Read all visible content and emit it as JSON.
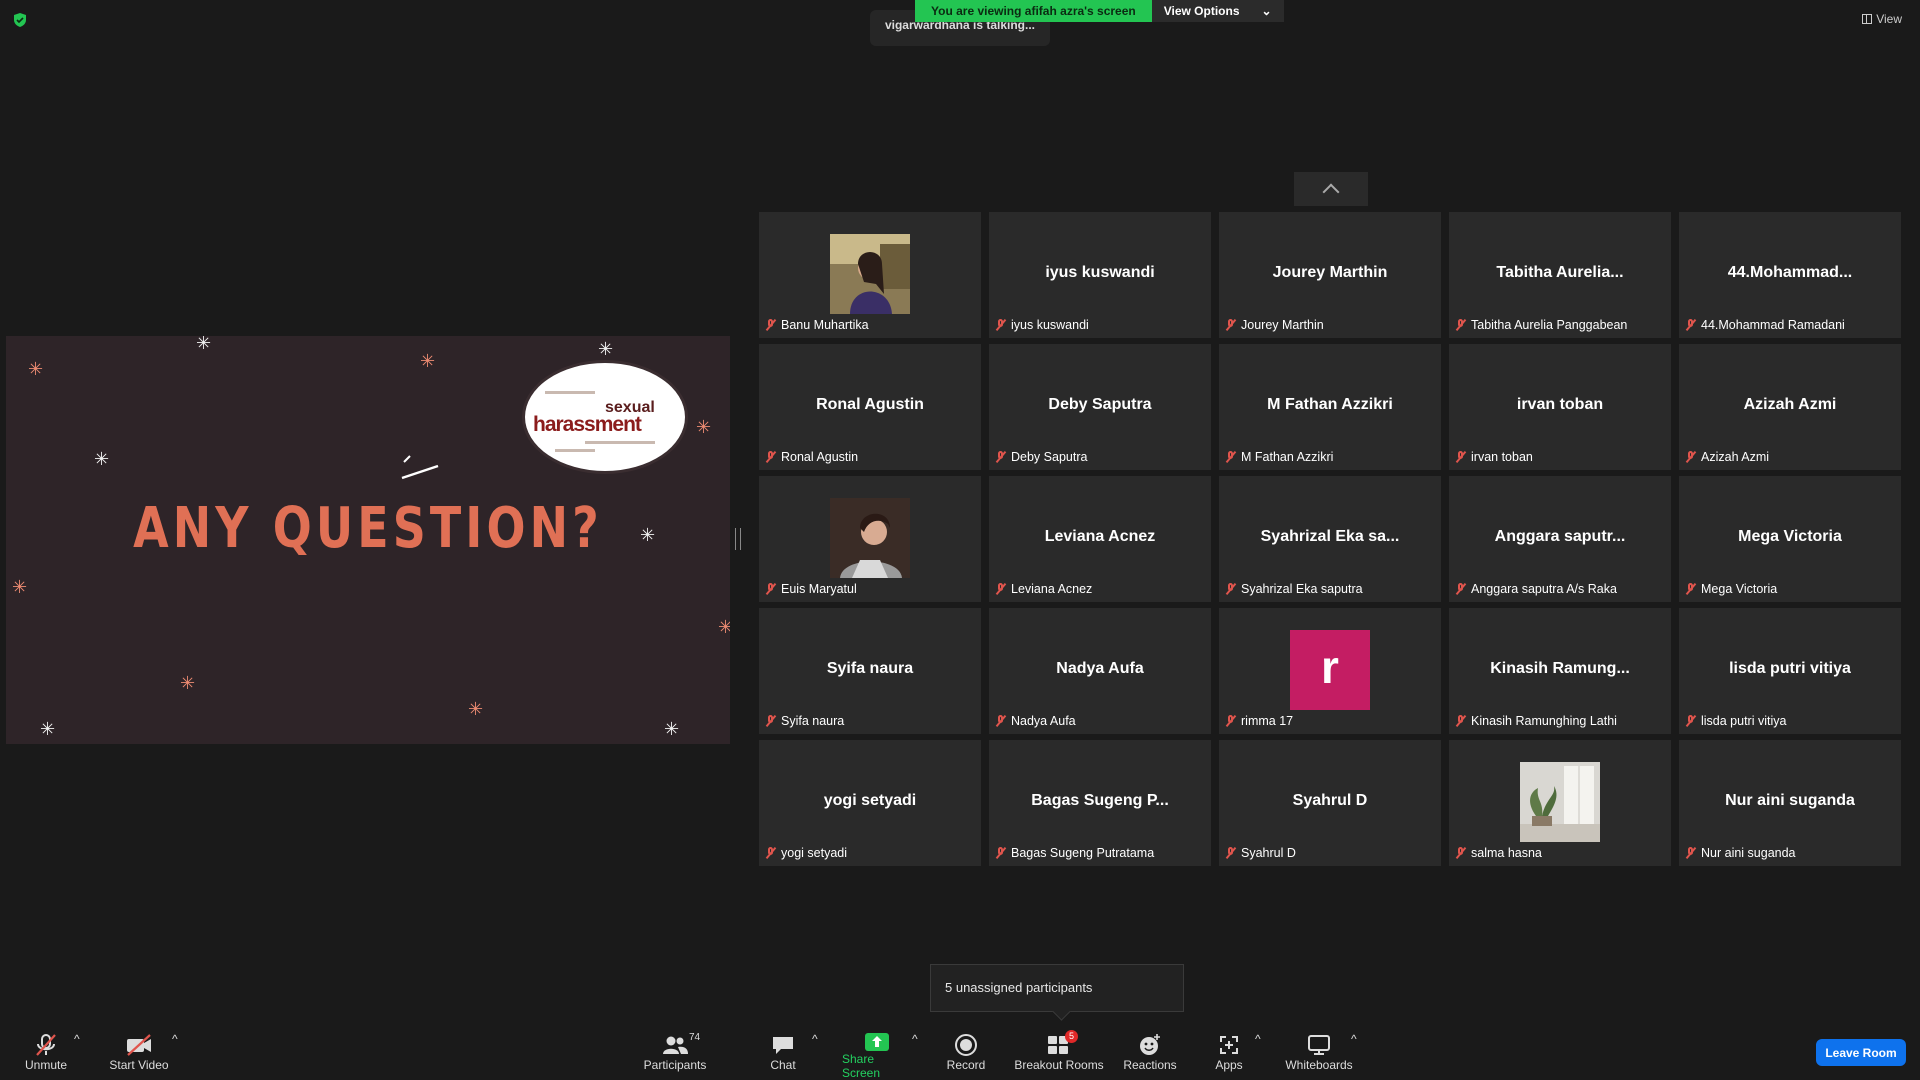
{
  "banner": {
    "viewing": "You are viewing afifah azra's screen",
    "options": "View Options"
  },
  "talking": "vigarwardhana is talking...",
  "view_btn": "View",
  "slide": {
    "title": "ANY QUESTION?",
    "wordcloud": {
      "line1": "sexual",
      "line2": "harassment"
    }
  },
  "participants_grid": [
    {
      "big": "",
      "label": "Banu Muhartika",
      "photo": "banu"
    },
    {
      "big": "iyus kuswandi",
      "label": "iyus kuswandi"
    },
    {
      "big": "Jourey Marthin",
      "label": "Jourey Marthin"
    },
    {
      "big": "Tabitha  Aurelia...",
      "label": "Tabitha Aurelia Panggabean"
    },
    {
      "big": "44.Mohammad...",
      "label": "44.Mohammad Ramadani"
    },
    {
      "big": "Ronal Agustin",
      "label": "Ronal Agustin"
    },
    {
      "big": "Deby Saputra",
      "label": "Deby Saputra"
    },
    {
      "big": "M Fathan Azzikri",
      "label": "M Fathan Azzikri"
    },
    {
      "big": "irvan toban",
      "label": "irvan toban"
    },
    {
      "big": "Azizah Azmi",
      "label": "Azizah Azmi"
    },
    {
      "big": "",
      "label": "Euis Maryatul",
      "photo": "euis"
    },
    {
      "big": "Leviana Acnez",
      "label": "Leviana Acnez"
    },
    {
      "big": "Syahrizal  Eka  sa...",
      "label": "Syahrizal Eka saputra"
    },
    {
      "big": "Anggara  saputr...",
      "label": "Anggara saputra A/s Raka"
    },
    {
      "big": "Mega Victoria",
      "label": "Mega Victoria"
    },
    {
      "big": "Syifa naura",
      "label": "Syifa naura"
    },
    {
      "big": "Nadya Aufa",
      "label": "Nadya Aufa"
    },
    {
      "big": "",
      "label": "rimma 17",
      "avatar": "r"
    },
    {
      "big": "Kinasih  Ramung...",
      "label": "Kinasih Ramunghing Lathi"
    },
    {
      "big": "lisda putri vitiya",
      "label": "lisda putri vitiya"
    },
    {
      "big": "yogi setyadi",
      "label": "yogi setyadi"
    },
    {
      "big": "Bagas  Sugeng  P...",
      "label": "Bagas Sugeng Putratama"
    },
    {
      "big": "Syahrul D",
      "label": "Syahrul D"
    },
    {
      "big": "",
      "label": "salma hasna",
      "photo": "salma"
    },
    {
      "big": "Nur aini suganda",
      "label": "Nur aini suganda"
    }
  ],
  "popup": "5 unassigned participants",
  "toolbar": {
    "unmute": "Unmute",
    "start_video": "Start Video",
    "participants": "Participants",
    "participants_count": "74",
    "chat": "Chat",
    "share_screen": "Share Screen",
    "record": "Record",
    "breakout_rooms": "Breakout Rooms",
    "breakout_badge": "5",
    "reactions": "Reactions",
    "apps": "Apps",
    "whiteboards": "Whiteboards",
    "leave": "Leave Room"
  },
  "colors": {
    "accent_green": "#23c552",
    "leave_blue": "#0e72ed",
    "muted_red": "#e0554d",
    "avatar_magenta": "#c41d63"
  }
}
